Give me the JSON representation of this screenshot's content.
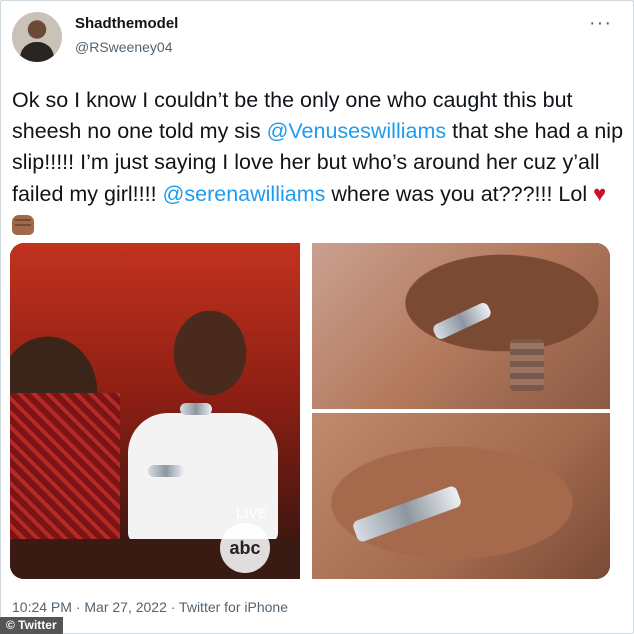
{
  "author": {
    "display_name": "Shadthemodel",
    "handle": "@RSweeney04"
  },
  "more_icon": "more-horizontal-icon",
  "tweet": {
    "text_part1": "Ok so I know I couldn’t be the only one who caught this but sheesh no one told my sis ",
    "mention1": "@Venuseswilliams",
    "text_part2": " that she had a nip slip!!!!! I’m just saying I love her but who’s around her cuz y’all failed my girl!!!! ",
    "mention2": "@serenawilliams",
    "text_part3": " where was you at???!!! Lol ",
    "emojis": [
      "red-heart",
      "raised-fist-medium-dark-skin"
    ]
  },
  "media": {
    "overlay_live": "LIVE",
    "overlay_logo": "abc"
  },
  "meta": {
    "timestamp": "10:24 PM · Mar 27, 2022 · Twitter for iPhone"
  },
  "source_credit": "© Twitter",
  "colors": {
    "mention": "#1d9bf0",
    "secondary_text": "#536471",
    "primary_text": "#0f1419"
  }
}
